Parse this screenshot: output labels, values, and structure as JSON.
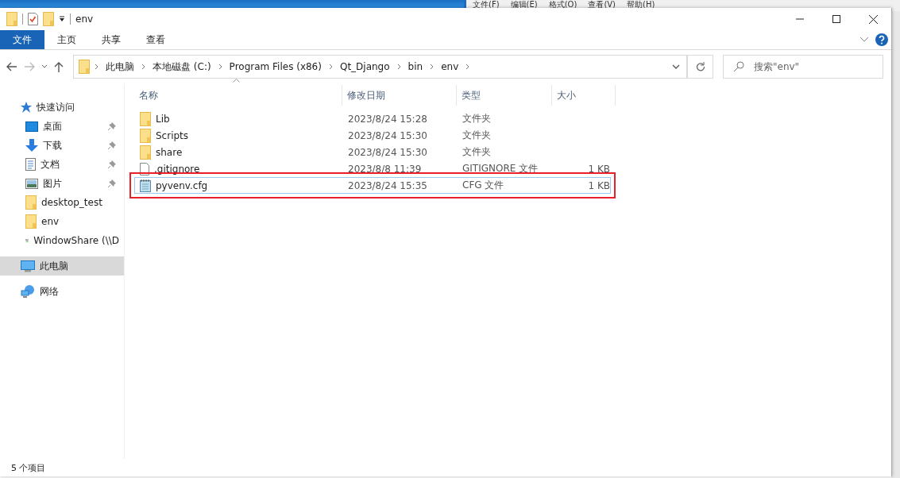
{
  "background_window": {
    "menu": [
      "文件(F)",
      "编辑(E)",
      "格式(O)",
      "查看(V)",
      "帮助(H)"
    ]
  },
  "window": {
    "title": "env"
  },
  "ribbon": {
    "tabs": [
      {
        "label": "文件",
        "selected": true
      },
      {
        "label": "主页",
        "selected": false
      },
      {
        "label": "共享",
        "selected": false
      },
      {
        "label": "查看",
        "selected": false
      }
    ]
  },
  "address_bar": {
    "path": [
      "此电脑",
      "本地磁盘 (C:)",
      "Program Files (x86)",
      "Qt_Django",
      "bin",
      "env"
    ]
  },
  "search": {
    "placeholder": "搜索\"env\""
  },
  "sidebar": {
    "items": [
      {
        "label": "快速访问",
        "kind": "star",
        "pinned": false,
        "selected": false,
        "children": [
          {
            "label": "桌面",
            "kind": "desktop",
            "pinned": true,
            "selected": false
          },
          {
            "label": "下载",
            "kind": "download",
            "pinned": true,
            "selected": false
          },
          {
            "label": "文档",
            "kind": "document",
            "pinned": true,
            "selected": false
          },
          {
            "label": "图片",
            "kind": "pictures",
            "pinned": true,
            "selected": false
          },
          {
            "label": "desktop_test",
            "kind": "folder",
            "pinned": false,
            "selected": false
          },
          {
            "label": "env",
            "kind": "folder",
            "pinned": false,
            "selected": false
          },
          {
            "label": "WindowShare (\\\\D",
            "kind": "share",
            "pinned": false,
            "selected": false
          }
        ]
      },
      {
        "label": "此电脑",
        "kind": "computer",
        "pinned": false,
        "selected": true
      },
      {
        "label": "网络",
        "kind": "network",
        "pinned": false,
        "selected": false
      }
    ]
  },
  "table": {
    "columns": [
      "名称",
      "修改日期",
      "类型",
      "大小"
    ],
    "rows": [
      {
        "kind": "folder",
        "name": "Lib",
        "date": "2023/8/24 15:28",
        "type": "文件夹",
        "highlighted": false
      },
      {
        "kind": "folder",
        "name": "Scripts",
        "date": "2023/8/24 15:30",
        "type": "文件夹",
        "highlighted": false
      },
      {
        "kind": "folder",
        "name": "share",
        "date": "2023/8/24 15:30",
        "type": "文件夹",
        "highlighted": false
      },
      {
        "kind": "file",
        "name": ".gitignore",
        "date": "2023/8/8 11:39",
        "type": "GITIGNORE 文件",
        "size": "1 KB",
        "highlighted": false
      },
      {
        "kind": "text",
        "name": "pyvenv.cfg",
        "date": "2023/8/24 15:35",
        "type": "CFG 文件",
        "size": "1 KB",
        "highlighted": true
      }
    ]
  },
  "status_bar": {
    "count": "5 个项目"
  }
}
